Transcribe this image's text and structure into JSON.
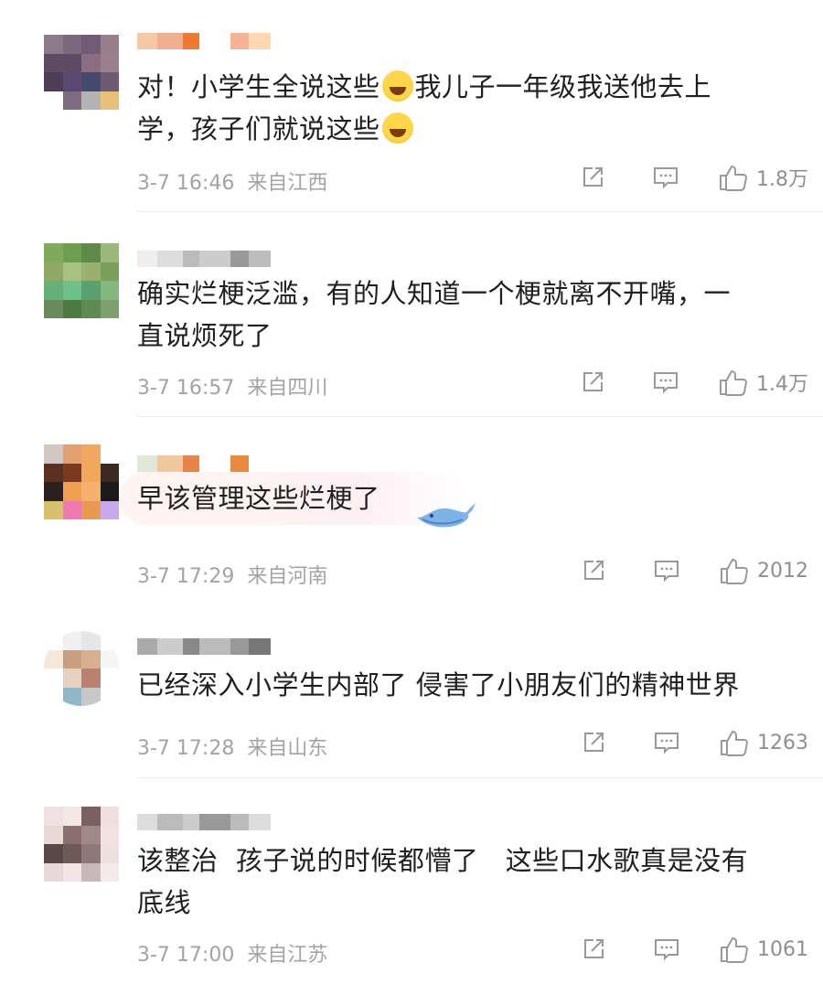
{
  "comments": [
    {
      "text_lines": [
        "对！小学生全说这些",
        "我儿子一年级我送他去上",
        "学，孩子们就说这些"
      ],
      "time": "3-7 16:46",
      "location": "来自江西",
      "likes": "1.8万",
      "avatar_colors": [
        "#8a7a8a",
        "#7b6a7e",
        "#6f5d76",
        "#9a7d8a",
        "#5c4b63",
        "#5d4a67",
        "#8b6e82",
        "#9c7f8d",
        "#4d3d56",
        "#5a4870",
        "#444a6a",
        "#6e5a73",
        "#fff",
        "#7f6b7f",
        "#b3b3b3",
        "#e8c077"
      ],
      "name_colors": [
        "#f5c8a8",
        "#f0b090",
        "#ed7a32",
        "#ffffff",
        "#f3b394",
        "#ffd7b2"
      ]
    },
    {
      "text_lines": [
        "确实烂梗泛滥，有的人知道一个梗就离不开嘴，一",
        "直说烦死了"
      ],
      "time": "3-7 16:57",
      "location": "来自四川",
      "likes": "1.4万",
      "avatar_colors": [
        "#7faa5e",
        "#6e9e52",
        "#5f8a4c",
        "#9cb97c",
        "#8fa868",
        "#a8c080",
        "#9ab070",
        "#78a05a",
        "#66b07a",
        "#70c08a",
        "#5aa070",
        "#84b87e",
        "#6a8a5c",
        "#4d7a40",
        "#5f8a54",
        "#7f9f6f"
      ],
      "name_colors": [
        "#eeeeee",
        "#dddddd",
        "#bbbbbb",
        "#cccccc",
        "#999999",
        "#bdbdbd"
      ]
    },
    {
      "text_lines": [
        "早该管理这些烂梗了"
      ],
      "time": "3-7 17:29",
      "location": "来自河南",
      "likes": "2012",
      "avatar_colors": [
        "#cfc7c0",
        "#e3a070",
        "#f0a860",
        "#ffffff",
        "#5a3020",
        "#7a3a20",
        "#f2a85a",
        "#3a2a20",
        "#2a2020",
        "#f0a050",
        "#f5b070",
        "#1a1a1a",
        "#d8c070",
        "#f07ab0",
        "#e89a50",
        "#c8a8e8"
      ],
      "name_colors": [
        "#dfe7d8",
        "#f0c8a0",
        "#e8844a",
        "#ffffff",
        "#ea8a40"
      ]
    },
    {
      "text_lines": [
        "已经深入小学生内部了 侵害了小朋友们的精神世界"
      ],
      "time": "3-7 17:28",
      "location": "来自山东",
      "likes": "1263",
      "avatar_colors": [
        "#ffffff",
        "#f0f0f0",
        "#e6e6e6",
        "#ffffff",
        "#f5e8d8",
        "#c8a080",
        "#d8b090",
        "#f5f5f5",
        "#ffffff",
        "#e8d0c0",
        "#b88070",
        "#ffffff",
        "#ffffff",
        "#90b8c8",
        "#c8c8c8",
        "#ffffff"
      ],
      "name_colors": [
        "#aaaaaa",
        "#cccccc",
        "#888888",
        "#bbbbbb",
        "#999999",
        "#777777"
      ]
    },
    {
      "text_lines": [
        "该整治  孩子说的时候都懵了   这些口水歌真是没有",
        "底线"
      ],
      "time": "3-7 17:00",
      "location": "来自江苏",
      "likes": "1061",
      "avatar_colors": [
        "#f0e0e0",
        "#f5e6e6",
        "#7a6060",
        "#f0dede",
        "#e8d8d8",
        "#8a7070",
        "#a08888",
        "#f2e2e2",
        "#5a4848",
        "#6e5858",
        "#907878",
        "#ece0e0",
        "#e8d8d8",
        "#f0e4e4",
        "#c8b8b8",
        "#f5eaea"
      ],
      "name_colors": [
        "#dddddd",
        "#bbbbbb",
        "#cccccc",
        "#999999",
        "#bbbbbb",
        "#dddddd"
      ]
    }
  ]
}
